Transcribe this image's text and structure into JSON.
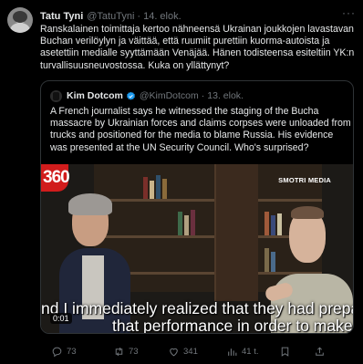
{
  "tweet": {
    "author_name": "Tatu Tyni",
    "author_handle": "@TatuTyni",
    "separator": "·",
    "date": "14. elok.",
    "more": "···",
    "text": "Ranskalainen toimittaja kertoo nähneensä Ukrainan joukkojen lavastavan Buchan verilöylyn ja väittää, että ruumiit purettiin kuorma-autoista ja asetettiin medialle syyttämään Venäjää. Hänen todisteensa esiteltiin YK:n turvallisuusneuvostossa. Kuka on yllättynyt?"
  },
  "quoted": {
    "author_name": "Kim Dotcom",
    "author_handle": "@KimDotcom",
    "date": "13. elok.",
    "text": "A French journalist says he witnessed the staging of the Bucha massacre by Ukrainian forces and claims corpses were unloaded from trucks and positioned for the media to blame Russia. His evidence was presented at the UN Security Council. Who's surprised?",
    "verified_color": "#1d9bf0",
    "video": {
      "channel_logo": "360",
      "watermark": "SMOTRI MEDIA",
      "subtitle_line1": "nd I immediately realized that they had prepar",
      "subtitle_line2": "that performance in order to make the most",
      "timestamp": "0:01"
    }
  },
  "actions": {
    "replies": "73",
    "reposts": "73",
    "likes": "341",
    "views": "41 t."
  },
  "colors": {
    "background": "#000000",
    "text": "#e7e9ea",
    "muted": "#71767b",
    "border": "#2f3336",
    "verified": "#1d9bf0"
  }
}
